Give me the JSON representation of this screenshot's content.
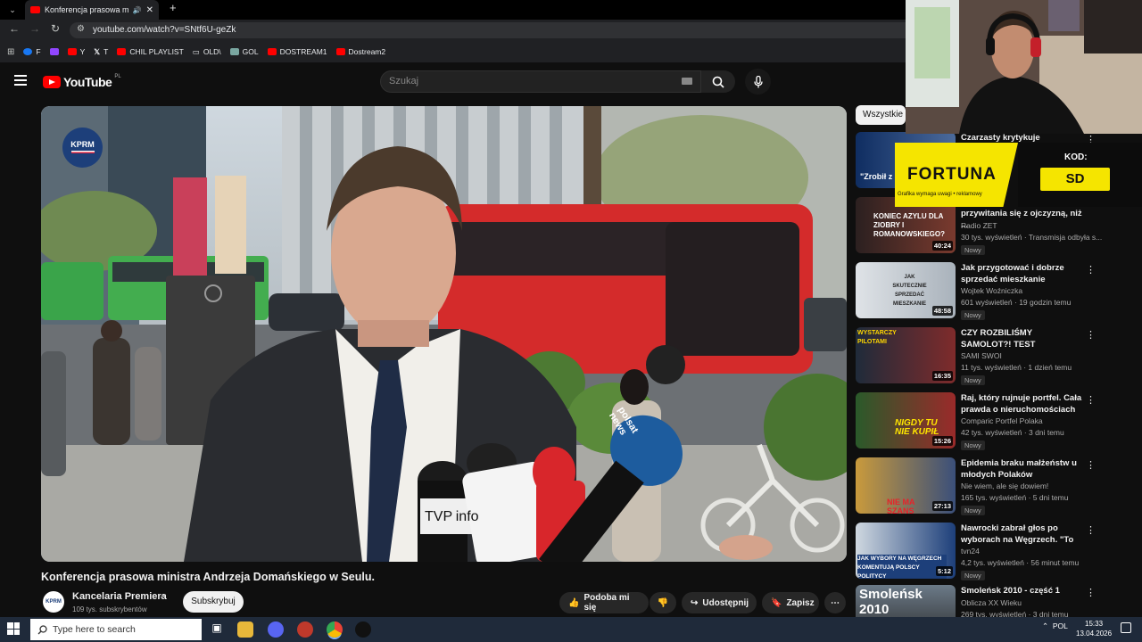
{
  "browser": {
    "tab_title": "Konferencja prasowa ministr",
    "url": "youtube.com/watch?v=SNtf6U-geZk",
    "bookmarks": [
      {
        "label": "F",
        "color": "#1877f2"
      },
      {
        "label": "",
        "color": "#9146ff"
      },
      {
        "label": "Y",
        "color": "#ff0000"
      },
      {
        "label": "T",
        "color": "#ffffff"
      },
      {
        "label": "CHIL PLAYLIST",
        "color": "#ff0000"
      },
      {
        "label": "OLD\\",
        "color": "#c4c7c5"
      },
      {
        "label": "GOL",
        "color": "#7aa7a1"
      },
      {
        "label": "DOSTREAM1",
        "color": "#ff0000"
      },
      {
        "label": "Dostream2",
        "color": "#ff0000"
      }
    ]
  },
  "youtube": {
    "logo_text": "YouTube",
    "region": "PL",
    "search_placeholder": "Szukaj",
    "video": {
      "watermark": "KPRM",
      "mic_labels": [
        "TVP",
        "info",
        "polsat news"
      ],
      "title": "Konferencja prasowa ministra Andrzeja Domańskiego w Seulu.",
      "channel": "Kancelaria Premiera",
      "subscribers": "109 tys. subskrybentów",
      "subscribe_label": "Subskrybuj",
      "like_label": "Podoba mi się",
      "share_label": "Udostępnij",
      "save_label": "Zapisz"
    },
    "filter_chip": "Wszystkie",
    "recommendations": [
      {
        "title": "Czarzasty krytykuje",
        "thumb_text": "\"Zrobił z",
        "channel": "",
        "meta": "",
        "badge": "",
        "duration": ""
      },
      {
        "title": "przywitania się z ojczyzną, niż ...",
        "thumb_text": "KONIEC AZYLU DLA ZIOBRY I ROMANOWSKIEGO?",
        "channel": "Radio ZET",
        "meta": "30 tys. wyświetleń · Transmisja odbyła s...",
        "badge": "Nowy",
        "duration": "40:24"
      },
      {
        "title": "Jak przygotować i dobrze sprzedać mieszkanie",
        "thumb_text": "JAK SKUTECZNIE SPRZEDAĆ MIESZKANIE",
        "channel": "Wojtek Woźniczka",
        "meta": "601 wyświetleń · 19 godzin temu",
        "badge": "Nowy",
        "duration": "48:58"
      },
      {
        "title": "CZY ROZBILIŚMY SAMOLOT?! TEST SYMULATORA BOEING ...",
        "thumb_text": "WYSTARCZY PILOTAMI",
        "channel": "SAMI SWOI",
        "meta": "11 tys. wyświetleń · 1 dzień temu",
        "badge": "Nowy",
        "duration": "16:35"
      },
      {
        "title": "Raj, który rujnuje portfel. Cała prawda o nieruchomościach w...",
        "thumb_text": "NIGDY TU NIE KUPIŁ",
        "channel": "Comparic Portfel Polaka",
        "meta": "42 tys. wyświetleń · 3 dni temu",
        "badge": "Nowy",
        "duration": "15:26"
      },
      {
        "title": "Epidemia braku małżeństw u młodych Polaków",
        "thumb_text": "NIE MA SZANS",
        "channel": "Nie wiem, ale się dowiem!",
        "meta": "165 tys. wyświetleń · 5 dni temu",
        "badge": "Nowy",
        "duration": "27:13"
      },
      {
        "title": "Nawrocki zabrał głos po wyborach na Węgrzech. \"To je...",
        "thumb_text": "JAK WYBORY NA WĘGRZECH KOMENTUJĄ POLSCY POLITYCY",
        "channel": "tvn24",
        "meta": "4,2 tys. wyświetleń · 56 minut temu",
        "badge": "Nowy",
        "duration": "5:12"
      },
      {
        "title": "Smoleńsk 2010 - część 1",
        "thumb_text": "Smoleńsk 2010",
        "channel": "Oblicza XX Wieku",
        "meta": "269 tys. wyświetleń · 3 dni temu",
        "badge": "",
        "duration": ""
      }
    ]
  },
  "overlay": {
    "brand": "FORTUNA",
    "brand_sub": "Grafika wymaga uwagi • reklamowy",
    "code_label": "KOD:",
    "code_value": "SD"
  },
  "taskbar": {
    "search_placeholder": "Type here to search",
    "language": "POL",
    "time": "15:33",
    "date": "13.04.2026"
  }
}
